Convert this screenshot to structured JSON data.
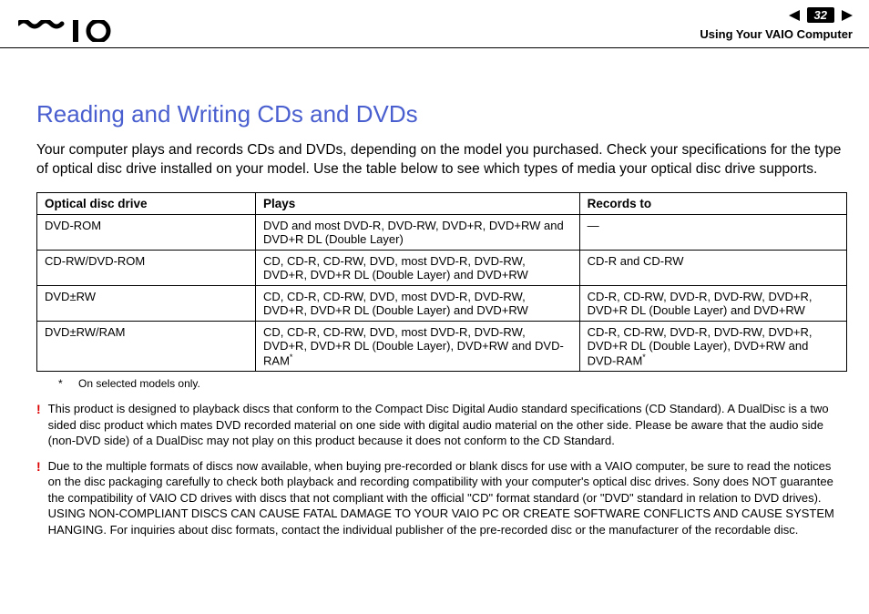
{
  "header": {
    "page_number": "32",
    "section": "Using Your VAIO Computer"
  },
  "title": "Reading and Writing CDs and DVDs",
  "intro": "Your computer plays and records CDs and DVDs, depending on the model you purchased. Check your specifications for the type of optical disc drive installed on your model. Use the table below to see which types of media your optical disc drive supports.",
  "table": {
    "headers": [
      "Optical disc drive",
      "Plays",
      "Records to"
    ],
    "rows": [
      {
        "drive": "DVD-ROM",
        "plays": "DVD and most DVD-R, DVD-RW, DVD+R, DVD+RW and DVD+R DL (Double Layer)",
        "records": "—"
      },
      {
        "drive": "CD-RW/DVD-ROM",
        "plays": "CD, CD-R, CD-RW, DVD, most DVD-R, DVD-RW, DVD+R, DVD+R DL (Double Layer) and DVD+RW",
        "records": "CD-R and CD-RW"
      },
      {
        "drive": "DVD±RW",
        "plays": "CD, CD-R, CD-RW, DVD, most DVD-R, DVD-RW, DVD+R, DVD+R DL (Double Layer) and DVD+RW",
        "records": "CD-R, CD-RW, DVD-R, DVD-RW, DVD+R, DVD+R DL (Double Layer) and DVD+RW"
      },
      {
        "drive": "DVD±RW/RAM",
        "plays": "CD, CD-R, CD-RW, DVD, most DVD-R, DVD-RW, DVD+R, DVD+R DL (Double Layer), DVD+RW and DVD-RAM",
        "plays_sup": "*",
        "records": "CD-R, CD-RW, DVD-R, DVD-RW, DVD+R, DVD+R DL (Double Layer), DVD+RW and DVD-RAM",
        "records_sup": "*"
      }
    ]
  },
  "footnote": {
    "mark": "*",
    "text": "On selected models only."
  },
  "warnings": [
    "This product is designed to playback discs that conform to the Compact Disc Digital Audio standard specifications (CD Standard). A DualDisc is a two sided disc product which mates DVD recorded material on one side with digital audio material on the other side. Please be aware that the audio side (non-DVD side) of a DualDisc may not play on this product because it does not conform to the CD Standard.",
    "Due to the multiple formats of discs now available, when buying pre-recorded or blank discs for use with a VAIO computer, be sure to read the notices on the disc packaging carefully to check both playback and recording compatibility with your computer's optical disc drives. Sony does NOT guarantee the compatibility of VAIO CD drives with discs that not compliant with the official \"CD\" format standard (or \"DVD\" standard in relation to DVD drives). USING NON-COMPLIANT DISCS CAN CAUSE FATAL DAMAGE TO YOUR VAIO PC OR CREATE SOFTWARE CONFLICTS AND CAUSE SYSTEM HANGING. For inquiries about disc formats, contact the individual publisher of the pre-recorded disc or the manufacturer of the recordable disc."
  ]
}
